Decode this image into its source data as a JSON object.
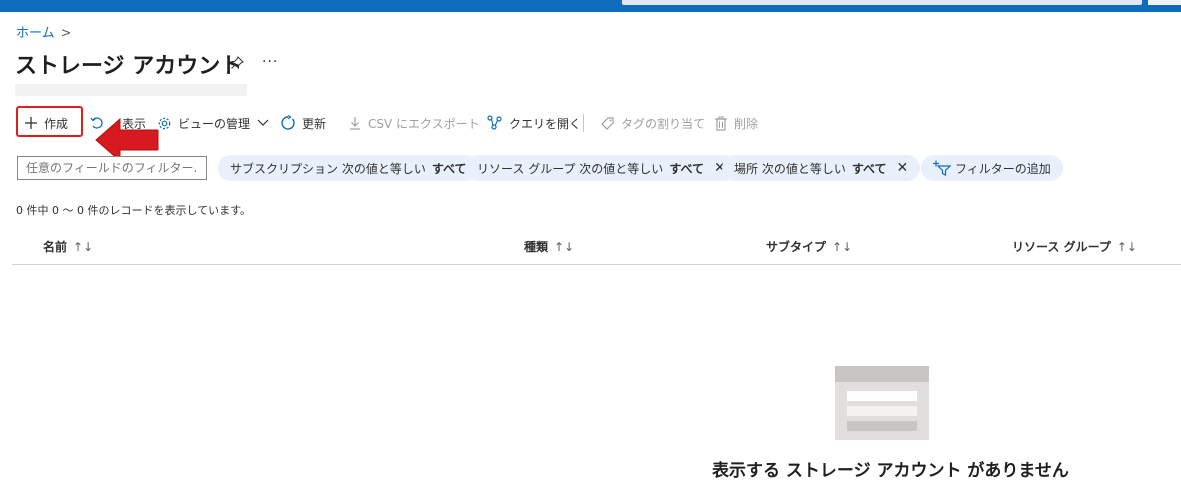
{
  "breadcrumb": {
    "home": "ホーム",
    "separator": ">"
  },
  "page": {
    "title": "ストレージ アカウント",
    "more": "···"
  },
  "toolbar": {
    "create": "作成",
    "hidden_view": "表示",
    "manage_view": "ビューの管理",
    "refresh": "更新",
    "export_csv": "CSV にエクスポート",
    "open_query": "クエリを開く",
    "assign_tags": "タグの割り当て",
    "delete": "削除"
  },
  "filters": {
    "placeholder": "任意のフィールドのフィルター...",
    "subscription": {
      "label": "サブスクリプション 次の値と等しい",
      "value": "すべて"
    },
    "resource_group": {
      "label": "リソース グループ 次の値と等しい",
      "value": "すべて"
    },
    "location": {
      "label": "場所 次の値と等しい",
      "value": "すべて"
    },
    "add_filter": "フィルターの追加"
  },
  "records": {
    "summary": "0 件中 0 ～ 0 件のレコードを表示しています。"
  },
  "table": {
    "columns": [
      {
        "label": "名前"
      },
      {
        "label": "種類"
      },
      {
        "label": "サブタイプ"
      },
      {
        "label": "リソース グループ"
      }
    ]
  },
  "empty_state": {
    "message": "表示する ストレージ アカウント がありません"
  },
  "colors": {
    "accent": "#0f6cbd",
    "highlight": "#e02020",
    "pill_bg": "#e8f1fb"
  }
}
